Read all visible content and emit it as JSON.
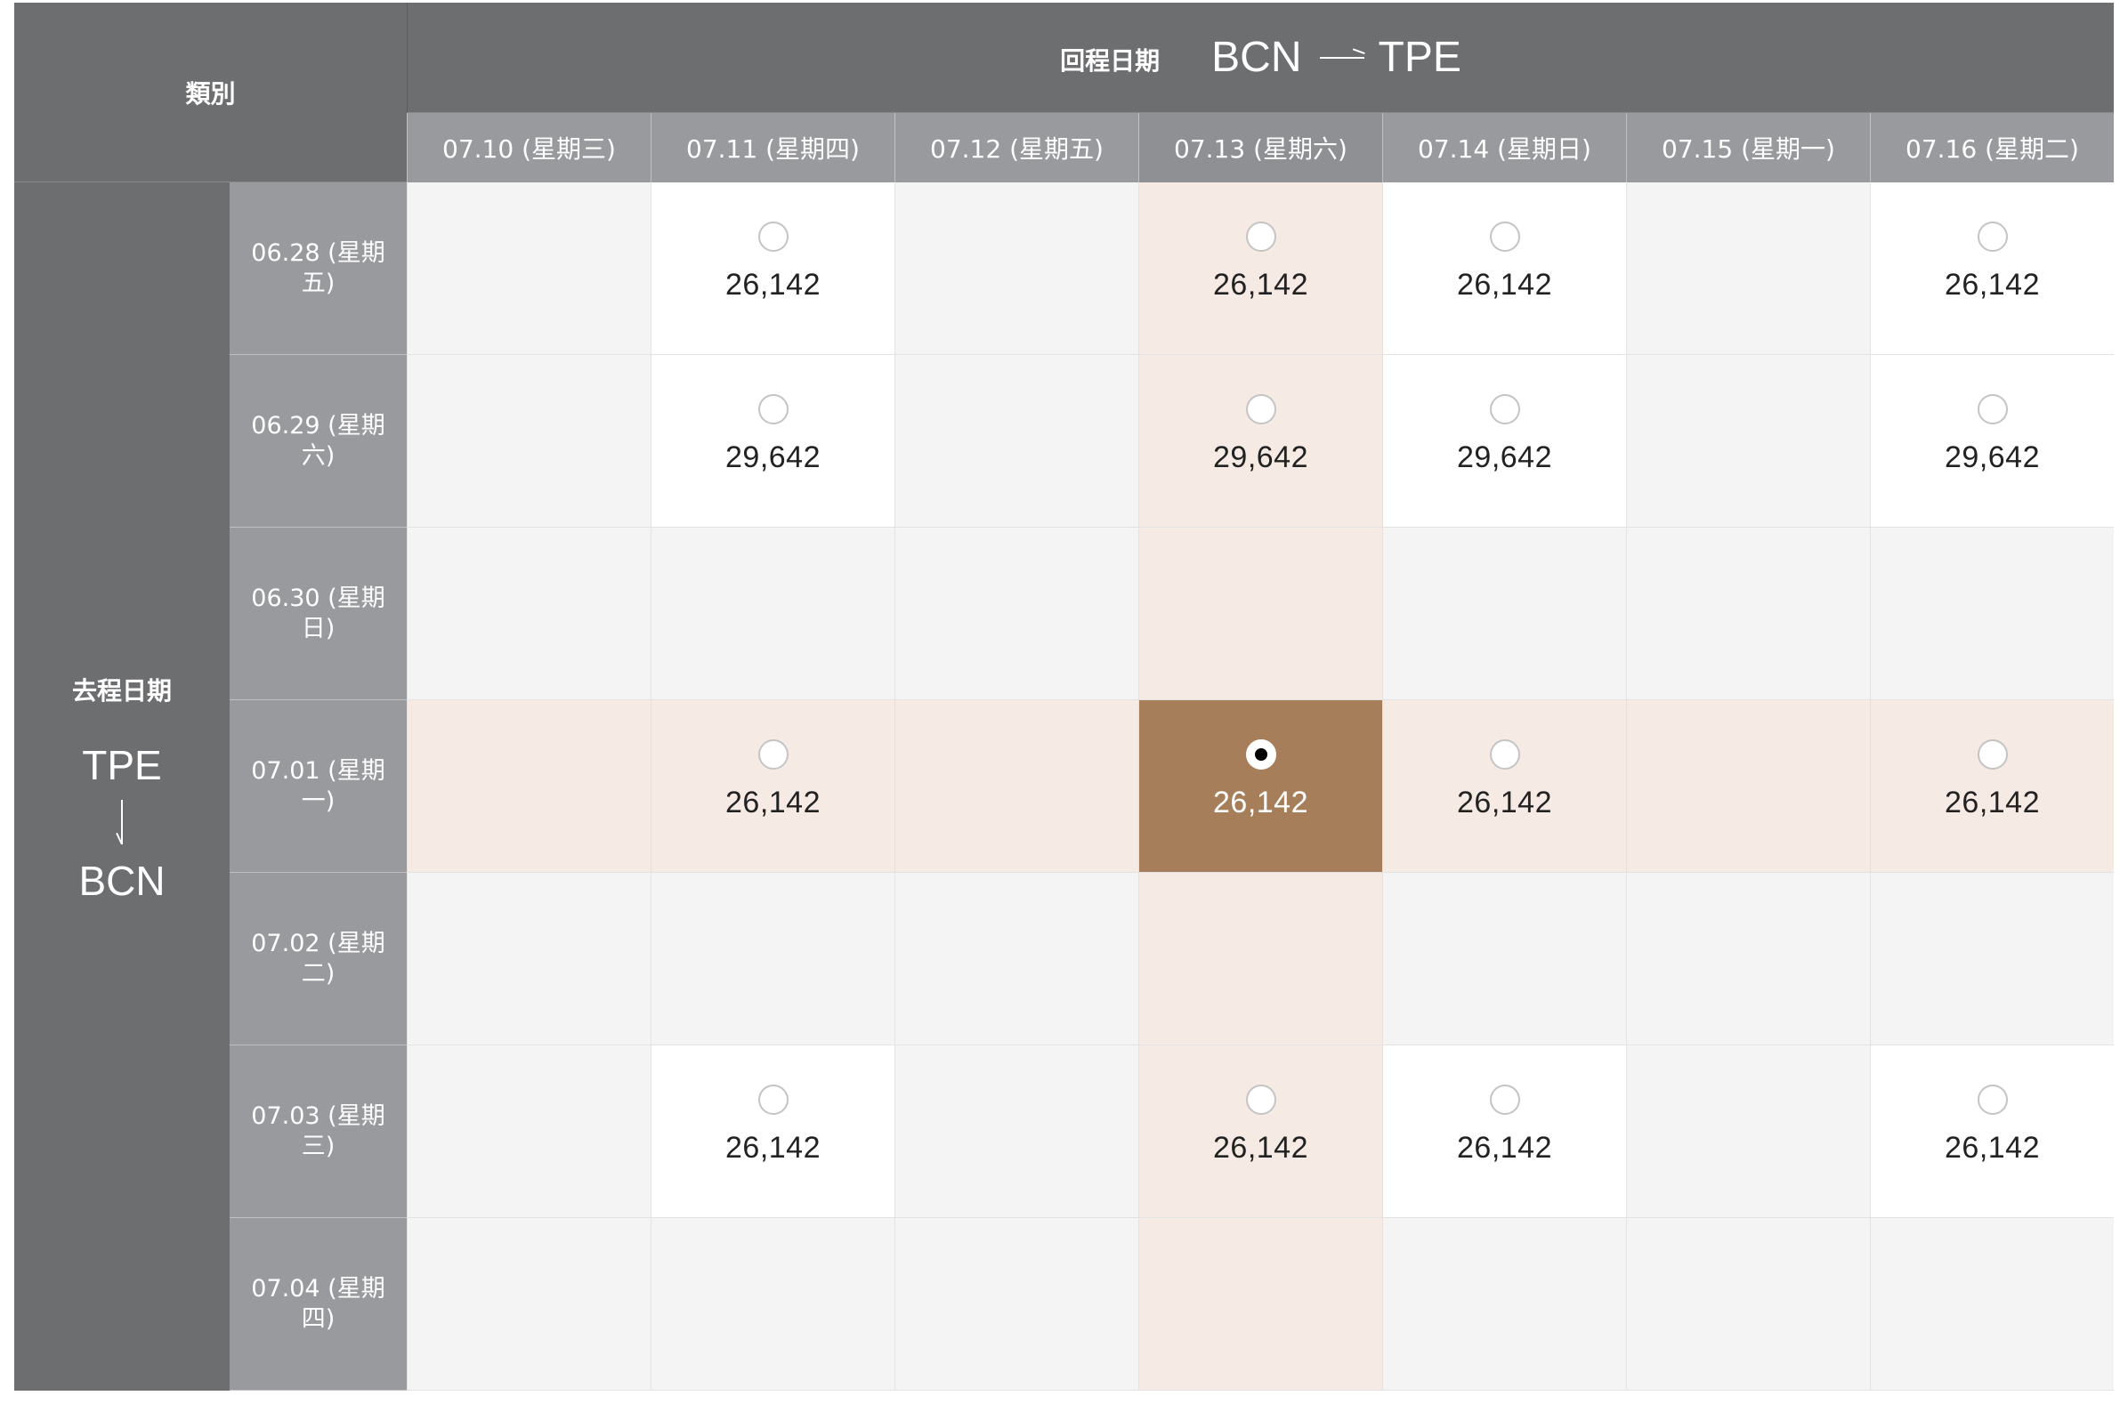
{
  "table": {
    "category_label": "類別",
    "return_label": "回程日期",
    "return_route": {
      "from": "BCN",
      "to": "TPE"
    },
    "outbound_label": "去程日期",
    "outbound_route": {
      "from": "TPE",
      "to": "BCN"
    }
  },
  "return_dates": [
    "07.10 (星期三)",
    "07.11 (星期四)",
    "07.12 (星期五)",
    "07.13 (星期六)",
    "07.14 (星期日)",
    "07.15 (星期一)",
    "07.16 (星期二)"
  ],
  "outbound_dates": [
    "06.28 (星期五)",
    "06.29 (星期六)",
    "06.30 (星期日)",
    "07.01 (星期一)",
    "07.02 (星期二)",
    "07.03 (星期三)",
    "07.04 (星期四)"
  ],
  "fares": [
    [
      null,
      "26,142",
      null,
      "26,142",
      "26,142",
      null,
      "26,142"
    ],
    [
      null,
      "29,642",
      null,
      "29,642",
      "29,642",
      null,
      "29,642"
    ],
    [
      null,
      null,
      null,
      null,
      null,
      null,
      null
    ],
    [
      null,
      "26,142",
      null,
      "26,142",
      "26,142",
      null,
      "26,142"
    ],
    [
      null,
      null,
      null,
      null,
      null,
      null,
      null
    ],
    [
      null,
      "26,142",
      null,
      "26,142",
      "26,142",
      null,
      "26,142"
    ],
    [
      null,
      null,
      null,
      null,
      null,
      null,
      null
    ]
  ],
  "selected": {
    "outbound_index": 3,
    "return_index": 3
  },
  "colors": {
    "header_dark": "#6d6e70",
    "header_light": "#989a9d",
    "highlight": "#f6ebe4",
    "selected": "#a77e5a",
    "unavailable": "#f4f4f4"
  }
}
